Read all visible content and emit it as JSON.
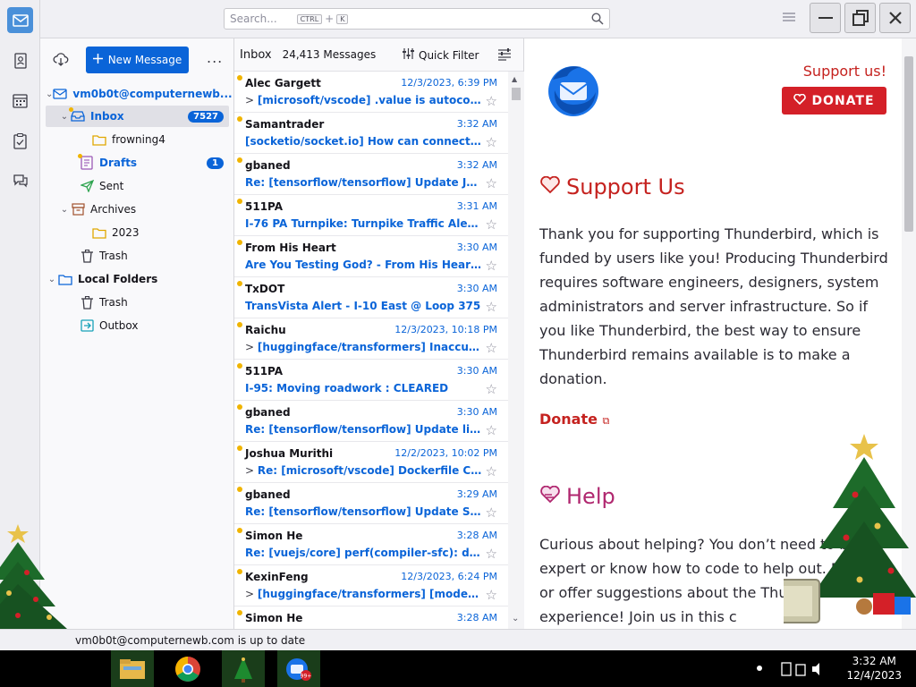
{
  "titlebar": {
    "search_placeholder": "Search...",
    "search_kbd_1": "CTRL",
    "search_plus": "+",
    "search_kbd_2": "K"
  },
  "folderpane": {
    "new_message": "New Message",
    "more": "...",
    "account": "vm0b0t@computernewb...",
    "folders": [
      {
        "label": "Inbox",
        "badge": "7527"
      },
      {
        "label": "frowning4"
      },
      {
        "label": "Drafts",
        "badge": "1"
      },
      {
        "label": "Sent"
      },
      {
        "label": "Archives"
      },
      {
        "label": "2023"
      },
      {
        "label": "Trash"
      },
      {
        "label": "Local Folders"
      },
      {
        "label": "Trash"
      },
      {
        "label": "Outbox"
      }
    ]
  },
  "threadpane": {
    "title": "Inbox",
    "count": "24,413 Messages",
    "quick_filter": "Quick Filter",
    "messages": [
      {
        "sender": "Alec Gargett",
        "date": "12/3/2023, 6:39 PM",
        "subject": "[microsoft/vscode] .value is autocorr..."
      },
      {
        "sender": "Samantrader",
        "date": "3:32 AM",
        "subject": "[socketio/socket.io] How can connect m..."
      },
      {
        "sender": "gbaned",
        "date": "3:32 AM",
        "subject": "Re: [tensorflow/tensorflow] Update Jax ..."
      },
      {
        "sender": "511PA",
        "date": "3:31 AM",
        "subject": "I-76 PA Turnpike: Turnpike Traffic Alert ..."
      },
      {
        "sender": "From His Heart",
        "date": "3:30 AM",
        "subject": "Are You Testing God? - From His Heart ..."
      },
      {
        "sender": "TxDOT",
        "date": "3:30 AM",
        "subject": "TransVista Alert - I-10 East @ Loop 375"
      },
      {
        "sender": "Raichu",
        "date": "12/3/2023, 10:18 PM",
        "subject": "[huggingface/transformers] Inaccurat..."
      },
      {
        "sender": "511PA",
        "date": "3:30 AM",
        "subject": "I-95: Moving roadwork : CLEARED"
      },
      {
        "sender": "gbaned",
        "date": "3:30 AM",
        "subject": "Re: [tensorflow/tensorflow] Update link..."
      },
      {
        "sender": "Joshua Murithi",
        "date": "12/2/2023, 10:02 PM",
        "subject": "Re: [microsoft/vscode] Dockerfile CO..."
      },
      {
        "sender": "gbaned",
        "date": "3:29 AM",
        "subject": "Re: [tensorflow/tensorflow] Update Sig..."
      },
      {
        "sender": "Simon He",
        "date": "3:28 AM",
        "subject": "Re: [vuejs/core] perf(compiler-sfc): defi..."
      },
      {
        "sender": "KexinFeng",
        "date": "12/3/2023, 6:24 PM",
        "subject": "[huggingface/transformers] [modelli..."
      },
      {
        "sender": "Simon He",
        "date": "3:28 AM",
        "subject": ""
      }
    ]
  },
  "messagepane": {
    "support_top": "Support us!",
    "donate_button": "DONATE",
    "support_heading": "Support Us",
    "support_text": "Thank you for supporting Thunderbird, which is funded by users like you! Producing Thunderbird requires software engineers, designers, system administrators and server infrastructure. So if you like Thunderbird, the best way to ensure Thunderbird remains available is to make a donation.",
    "donate_link": "Donate",
    "help_heading": "Help",
    "help_text": "Curious about helping? You don’t need to be an expert or know how to code to help out. Report or offer suggestions about the Thunderbird experience! Join us in this c"
  },
  "statusbar": {
    "text": "vm0b0t@computernewb.com is up to date"
  },
  "taskbar": {
    "time": "3:32 AM",
    "date": "12/4/2023",
    "badge": "99+"
  },
  "colors": {
    "accent": "#0a64d8",
    "donate": "#d42028",
    "support": "#c5221f",
    "help": "#b0276f"
  }
}
